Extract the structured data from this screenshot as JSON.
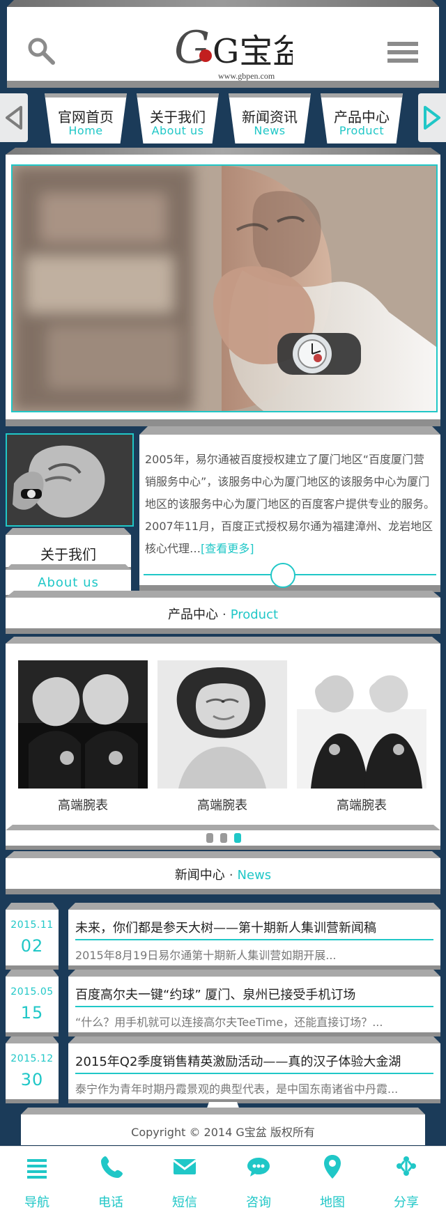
{
  "header": {
    "logo_alt_text": "G宝盆",
    "logo_url": "www.gbpen.com"
  },
  "nav": {
    "items": [
      {
        "zh": "官网首页",
        "en": "Home"
      },
      {
        "zh": "关于我们",
        "en": "About us"
      },
      {
        "zh": "新闻资讯",
        "en": "News"
      },
      {
        "zh": "产品中心",
        "en": "Product"
      }
    ]
  },
  "about": {
    "title_zh": "关于我们",
    "title_en": "About us",
    "text": "2005年，易尔通被百度授权建立了厦门地区“百度厦门营销服务中心”，该服务中心为厦门地区的该服务中心为厦门地区的该服务中心为厦门地区的百度客户提供专业的服务。2007年11月，百度正式授权易尔通为福建漳州、龙岩地区核心代理…",
    "more": "[查看更多]"
  },
  "product": {
    "title_zh": "产品中心",
    "title_en": "Product",
    "items": [
      {
        "label": "高端腕表"
      },
      {
        "label": "高端腕表"
      },
      {
        "label": "高端腕表"
      }
    ],
    "pager_active_index": 2
  },
  "news": {
    "title_zh": "新闻中心",
    "title_en": "News",
    "items": [
      {
        "ym": "2015.11",
        "day": "02",
        "title": "未来，你们都是参天大树——第十期新人集训营新闻稿",
        "sub": "2015年8月19日易尔通第十期新人集训营如期开展..."
      },
      {
        "ym": "2015.05",
        "day": "15",
        "title": "百度高尔夫一键“约球” 厦门、泉州已接受手机订场",
        "sub": "“什么？用手机就可以连接高尔夫TeeTime，还能直接订场？..."
      },
      {
        "ym": "2015.12",
        "day": "30",
        "title": "2015年Q2季度销售精英激励活动——真的汉子体验大金湖",
        "sub": "泰宁作为青年时期丹霞景观的典型代表，是中国东南诸省中丹霞..."
      }
    ]
  },
  "footer": {
    "copyright": "Copyright © 2014 G宝盆 版权所有"
  },
  "bottom_tabs": [
    {
      "label": "导航",
      "icon": "menu-icon"
    },
    {
      "label": "电话",
      "icon": "phone-icon"
    },
    {
      "label": "短信",
      "icon": "mail-icon"
    },
    {
      "label": "咨询",
      "icon": "chat-icon"
    },
    {
      "label": "地图",
      "icon": "map-pin-icon"
    },
    {
      "label": "分享",
      "icon": "share-icon"
    }
  ],
  "colors": {
    "navy": "#1b3b59",
    "accent_cyan": "#20c7c7",
    "panel": "#ffffff"
  }
}
